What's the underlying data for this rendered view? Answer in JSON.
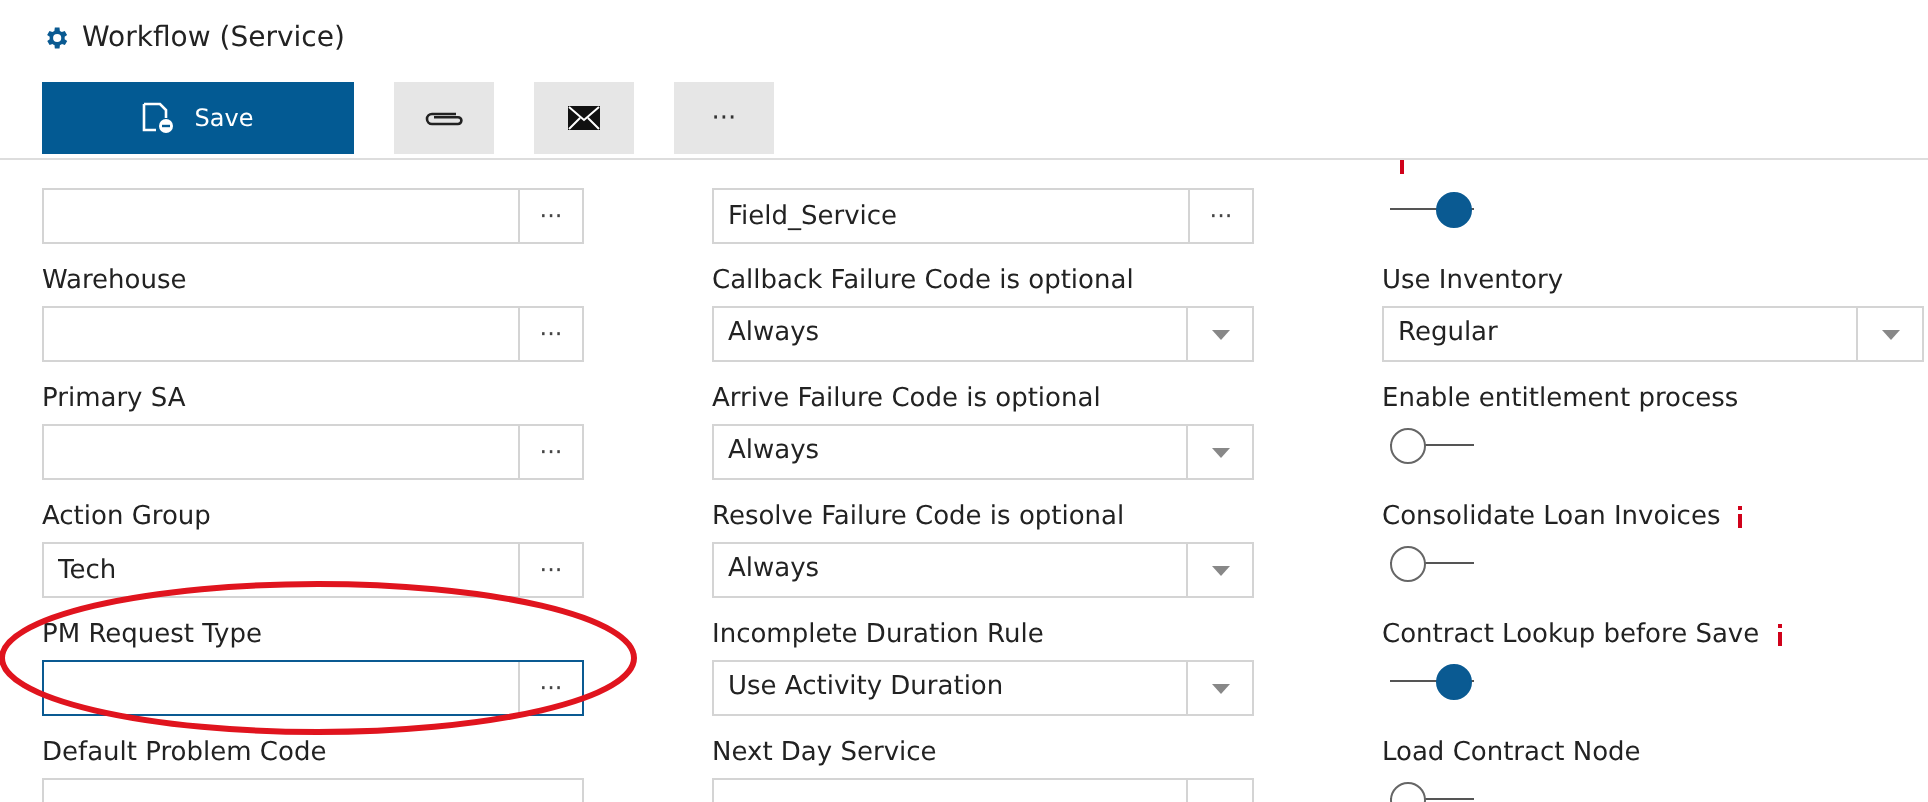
{
  "window": {
    "title": "Workflow (Service)"
  },
  "toolbar": {
    "save_label": "Save",
    "more_label": "···"
  },
  "columns": [
    {
      "fields": [
        {
          "kind": "lookup",
          "focused": false,
          "button": "···"
        },
        {
          "label": "Warehouse",
          "kind": "lookup",
          "focused": false,
          "button": "···"
        },
        {
          "label": "Primary SA",
          "kind": "lookup",
          "focused": false,
          "button": "···"
        },
        {
          "label": "Action Group",
          "kind": "lookup",
          "value": "Tech",
          "focused": false,
          "button": "···"
        },
        {
          "label": "PM Request Type",
          "kind": "lookup",
          "focused": true,
          "button": "···",
          "highlighted": true
        },
        {
          "label": "Default Problem Code",
          "kind": "lookup",
          "focused": false
        }
      ]
    },
    {
      "fields": [
        {
          "kind": "lookup",
          "value": "Field_Service",
          "focused": false,
          "button": "···"
        },
        {
          "label": "Callback Failure Code is optional",
          "kind": "select",
          "value": "Always"
        },
        {
          "label": "Arrive Failure Code is optional",
          "kind": "select",
          "value": "Always"
        },
        {
          "label": "Resolve Failure Code is optional",
          "kind": "select",
          "value": "Always"
        },
        {
          "label": "Incomplete Duration Rule",
          "kind": "select",
          "value": "Use Activity Duration"
        },
        {
          "label": "Next Day Service",
          "kind": "select"
        }
      ]
    },
    {
      "fields": [
        {
          "kind": "toggle",
          "on": true,
          "info": true
        },
        {
          "label": "Use Inventory",
          "kind": "select",
          "value": "Regular"
        },
        {
          "label": "Enable entitlement process",
          "kind": "toggle",
          "on": false
        },
        {
          "label": "Consolidate Loan Invoices",
          "kind": "toggle",
          "on": false,
          "info": true
        },
        {
          "label": "Contract Lookup before Save",
          "kind": "toggle",
          "on": true,
          "info": true
        },
        {
          "label": "Load Contract Node",
          "kind": "toggle",
          "on": false
        }
      ]
    }
  ]
}
